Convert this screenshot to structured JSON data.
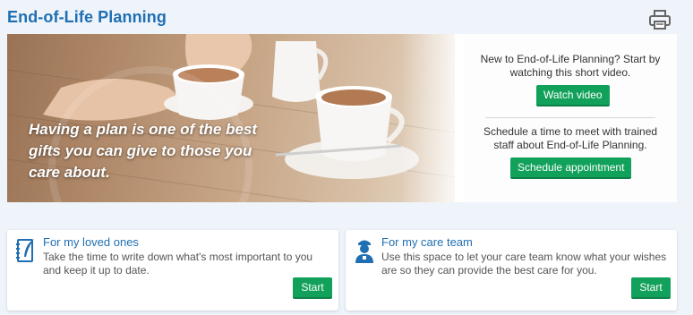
{
  "page": {
    "title": "End-of-Life Planning"
  },
  "icons": {
    "print": "printer-icon",
    "loved_ones": "notebook-quill-icon",
    "care_team": "caregiver-icon"
  },
  "colors": {
    "brand_blue": "#1f6fb2",
    "accent_green": "#12a15a",
    "background": "#eef4fa"
  },
  "hero": {
    "quote": "Having a plan is one of the best gifts you can give to those you care about.",
    "video": {
      "text": "New to End-of-Life Planning? Start by watching this short video.",
      "button": "Watch video"
    },
    "appointment": {
      "text": "Schedule a time to meet with trained staff about End-of-Life Planning.",
      "button": "Schedule appointment"
    }
  },
  "cards": [
    {
      "title": "For my loved ones",
      "description": "Take the time to write down what's most important to you and keep it up to date.",
      "button": "Start"
    },
    {
      "title": "For my care team",
      "description": "Use this space to let your care team know what your wishes are so they can provide the best care for you.",
      "button": "Start"
    }
  ]
}
